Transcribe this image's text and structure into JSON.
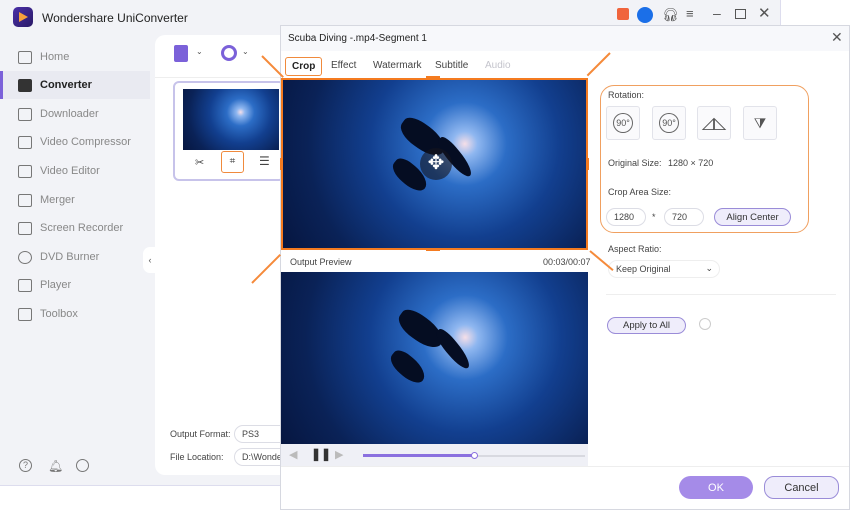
{
  "app": {
    "title": "Wondershare UniConverter"
  },
  "sidebar": {
    "items": [
      {
        "label": "Home"
      },
      {
        "label": "Converter"
      },
      {
        "label": "Downloader"
      },
      {
        "label": "Video Compressor"
      },
      {
        "label": "Video Editor"
      },
      {
        "label": "Merger"
      },
      {
        "label": "Screen Recorder"
      },
      {
        "label": "DVD Burner"
      },
      {
        "label": "Player"
      },
      {
        "label": "Toolbox"
      }
    ]
  },
  "converter": {
    "output_format_label": "Output Format:",
    "output_format_value": "PS3",
    "file_location_label": "File Location:",
    "file_location_value": "D:\\Wonde"
  },
  "dialog": {
    "title": "Scuba Diving -.mp4-Segment 1",
    "tabs": [
      {
        "label": "Crop"
      },
      {
        "label": "Effect"
      },
      {
        "label": "Watermark"
      },
      {
        "label": "Subtitle"
      },
      {
        "label": "Audio"
      }
    ],
    "output_preview_label": "Output Preview",
    "time": "00:03/00:07",
    "progress": 0.5,
    "rotation_label": "Rotation:",
    "rot_cw": "90°",
    "rot_ccw": "90°",
    "original_size_label": "Original Size:",
    "original_size_value": "1280 × 720",
    "crop_area_label": "Crop Area Size:",
    "crop_width": "1280",
    "crop_sep": "*",
    "crop_height": "720",
    "align_center": "Align Center",
    "aspect_ratio_label": "Aspect Ratio:",
    "aspect_ratio_value": "Keep Original",
    "apply_all": "Apply to All",
    "ok": "OK",
    "cancel": "Cancel"
  },
  "colors": {
    "accent": "#7b61d9",
    "highlight": "#f47b20"
  }
}
